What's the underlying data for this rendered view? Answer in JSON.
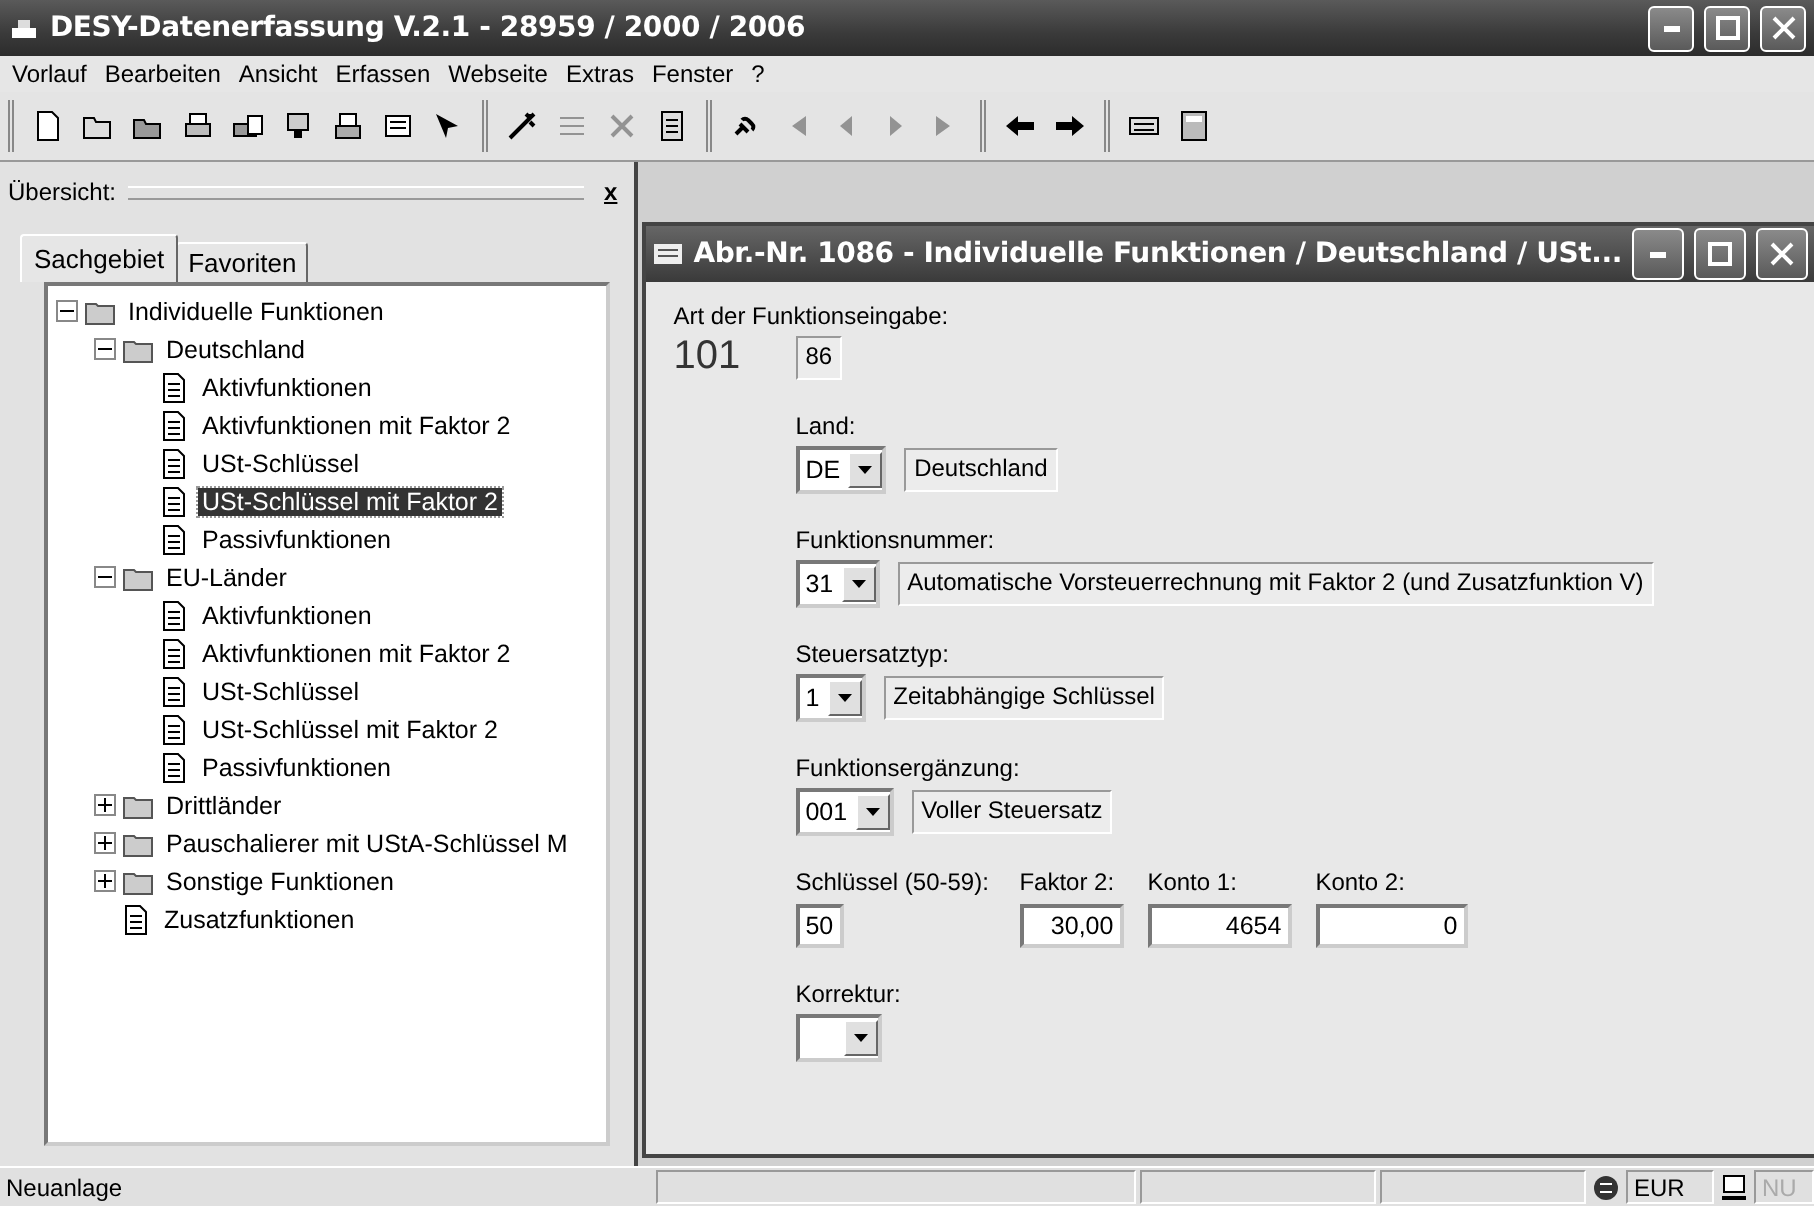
{
  "window": {
    "title": "DESY-Datenerfassung V.2.1 - 28959 / 2000 / 2006"
  },
  "menu": [
    "Vorlauf",
    "Bearbeiten",
    "Ansicht",
    "Erfassen",
    "Webseite",
    "Extras",
    "Fenster",
    "?"
  ],
  "toolbar": [
    {
      "buttons": [
        {
          "disabled": false
        },
        {
          "disabled": false
        },
        {
          "disabled": false
        },
        {
          "disabled": false
        },
        {
          "disabled": false
        },
        {
          "disabled": false
        },
        {
          "disabled": false
        },
        {
          "disabled": false
        },
        {
          "disabled": false
        }
      ]
    },
    {
      "buttons": [
        {
          "disabled": false
        },
        {
          "disabled": true
        },
        {
          "disabled": true
        },
        {
          "disabled": false
        }
      ]
    },
    {
      "buttons": [
        {
          "disabled": false
        },
        {
          "disabled": true
        },
        {
          "disabled": true
        },
        {
          "disabled": true
        },
        {
          "disabled": true
        }
      ]
    },
    {
      "buttons": [
        {
          "disabled": false
        },
        {
          "disabled": false
        }
      ]
    },
    {
      "buttons": [
        {
          "disabled": false
        },
        {
          "disabled": false
        }
      ]
    }
  ],
  "sidebar": {
    "title": "Übersicht:",
    "close": "x",
    "tabs": [
      {
        "label": "Sachgebiet",
        "selected": true
      },
      {
        "label": "Favoriten",
        "selected": false
      }
    ],
    "tree": [
      {
        "label": "Individuelle Funktionen",
        "kind": "folder",
        "expanded": true,
        "selected": false,
        "children": [
          {
            "label": "Deutschland",
            "kind": "folder",
            "expanded": true,
            "selected": false,
            "children": [
              {
                "label": "Aktivfunktionen",
                "kind": "document",
                "selected": false
              },
              {
                "label": "Aktivfunktionen mit Faktor 2",
                "kind": "document",
                "selected": false
              },
              {
                "label": "USt-Schlüssel",
                "kind": "document",
                "selected": false
              },
              {
                "label": "USt-Schlüssel mit Faktor 2",
                "kind": "document",
                "selected": true
              },
              {
                "label": "Passivfunktionen",
                "kind": "document",
                "selected": false
              }
            ]
          },
          {
            "label": "EU-Länder",
            "kind": "folder",
            "expanded": true,
            "selected": false,
            "children": [
              {
                "label": "Aktivfunktionen",
                "kind": "document",
                "selected": false
              },
              {
                "label": "Aktivfunktionen mit Faktor 2",
                "kind": "document",
                "selected": false
              },
              {
                "label": "USt-Schlüssel",
                "kind": "document",
                "selected": false
              },
              {
                "label": "USt-Schlüssel mit Faktor 2",
                "kind": "document",
                "selected": false
              },
              {
                "label": "Passivfunktionen",
                "kind": "document",
                "selected": false
              }
            ]
          },
          {
            "label": "Drittländer",
            "kind": "folder",
            "expanded": false,
            "selected": false
          },
          {
            "label": "Pauschalierer mit UStA-Schlüssel M",
            "kind": "folder",
            "expanded": false,
            "selected": false
          },
          {
            "label": "Sonstige Funktionen",
            "kind": "folder",
            "expanded": false,
            "selected": false
          },
          {
            "label": "Zusatzfunktionen",
            "kind": "document",
            "selected": false
          }
        ]
      }
    ]
  },
  "form": {
    "title": "Abr.-Nr. 1086 - Individuelle Funktionen / Deutschland / USt...",
    "entry_type": {
      "label": "Art der Funktionseingabe:",
      "code": "101",
      "value": "86"
    },
    "selectors": [
      {
        "label": "Land:",
        "code": "DE",
        "description": "Deutschland"
      },
      {
        "label": "Funktionsnummer:",
        "code": "31",
        "description": "Automatische Vorsteuerrechnung  mit Faktor 2 (und Zusatzfunktion V)"
      },
      {
        "label": "Steuersatztyp:",
        "code": "1",
        "description": "Zeitabhängige Schlüssel"
      },
      {
        "label": "Funktionsergänzung:",
        "code": "001",
        "description": "Voller Steuersatz"
      }
    ],
    "fields": [
      {
        "label": "Schlüssel (50-59):",
        "value": "50",
        "kind": "text"
      },
      {
        "label": "Faktor 2:",
        "value": "30,00",
        "kind": "number"
      },
      {
        "label": "Konto 1:",
        "value": "4654",
        "kind": "number"
      },
      {
        "label": "Konto 2:",
        "value": "0",
        "kind": "number"
      }
    ],
    "correction": {
      "label": "Korrektur:"
    }
  },
  "status_bar": {
    "message": "Neuanlage",
    "currency": "EUR",
    "num_lock": {
      "label": "NU",
      "on": false
    }
  }
}
